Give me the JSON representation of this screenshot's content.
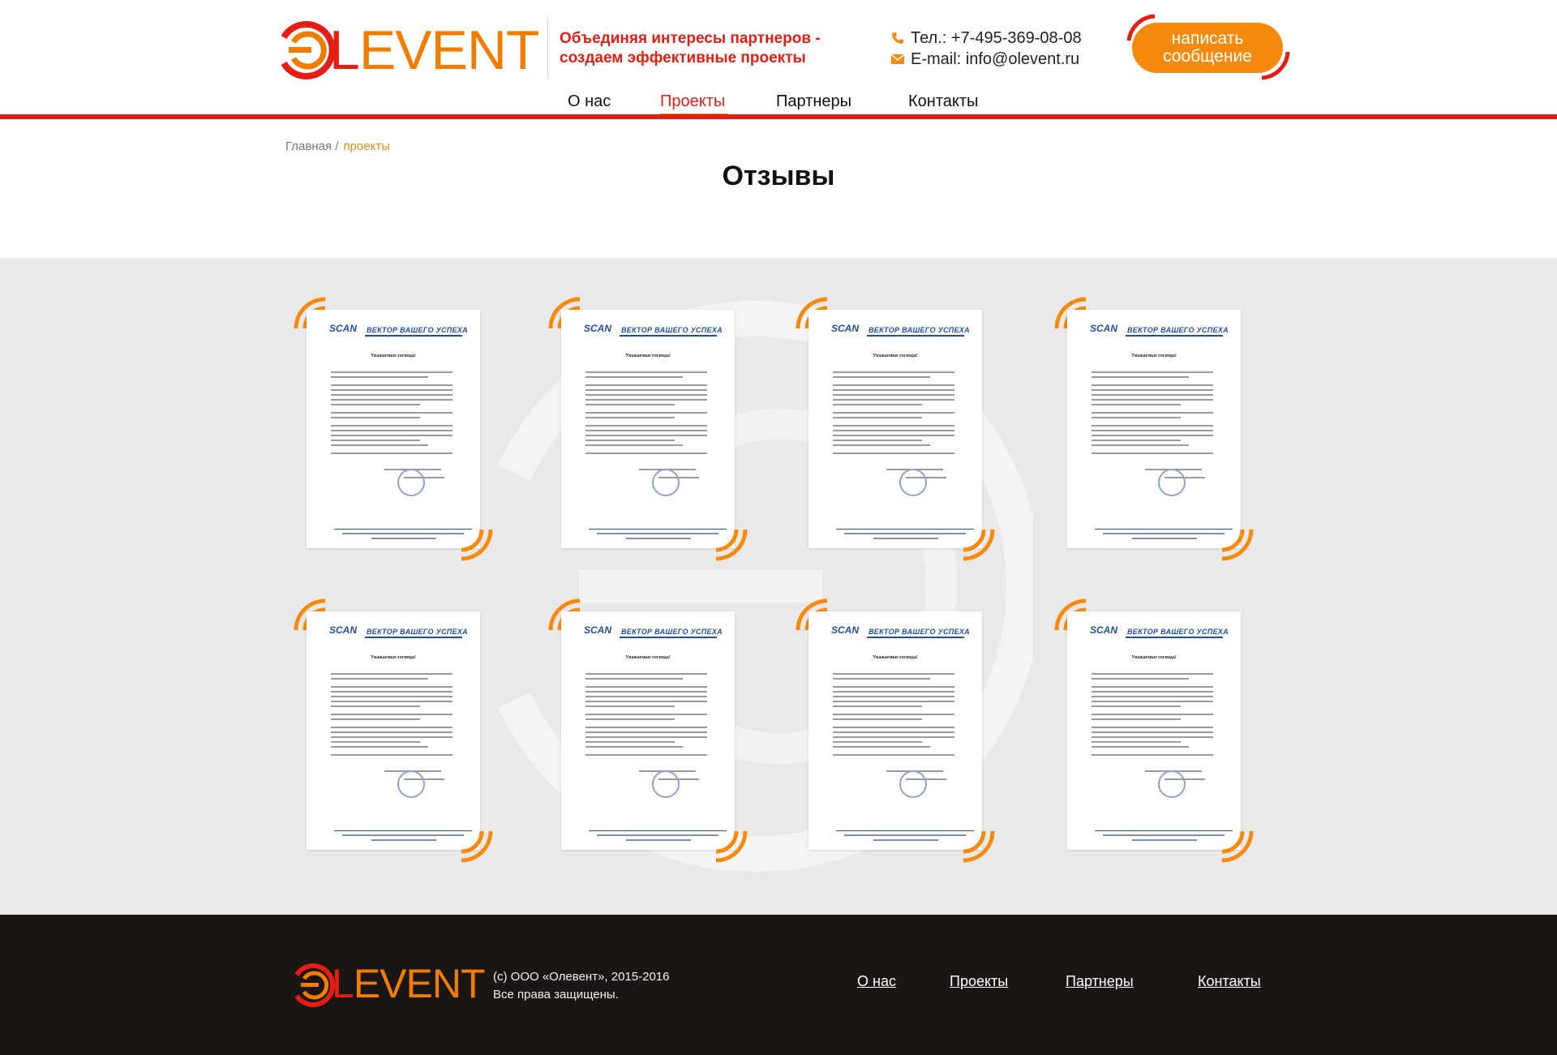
{
  "header": {
    "logo_text_first": "L",
    "logo_text_rest": "EVENT",
    "tagline_line1": "Объединяя интересы партнеров -",
    "tagline_line2": "создаем эффективные проекты",
    "phone": "Тел.: +7-495-369-08-08",
    "email": "E-mail: info@olevent.ru",
    "message_button_label": "написать сообщение",
    "icons": {
      "phone": "phone-icon",
      "email": "envelope-icon"
    },
    "nav": [
      {
        "label": "О нас",
        "active": false
      },
      {
        "label": "Проекты",
        "active": true
      },
      {
        "label": "Партнеры",
        "active": false
      },
      {
        "label": "Контакты",
        "active": false
      }
    ]
  },
  "breadcrumb": {
    "home": "Главная /",
    "current": "проекты"
  },
  "page_title": "Отзывы",
  "reviews": {
    "items": [
      {
        "scan": "SCAN",
        "motto": "ВЕКТОР ВАШЕГО УСПЕХА",
        "greeting": "Уважаемые господа!"
      },
      {
        "scan": "SCAN",
        "motto": "ВЕКТОР ВАШЕГО УСПЕХА",
        "greeting": "Уважаемые господа!"
      },
      {
        "scan": "SCAN",
        "motto": "ВЕКТОР ВАШЕГО УСПЕХА",
        "greeting": "Уважаемые господа!"
      },
      {
        "scan": "SCAN",
        "motto": "ВЕКТОР ВАШЕГО УСПЕХА",
        "greeting": "Уважаемые господа!"
      },
      {
        "scan": "SCAN",
        "motto": "ВЕКТОР ВАШЕГО УСПЕХА",
        "greeting": "Уважаемые господа!"
      },
      {
        "scan": "SCAN",
        "motto": "ВЕКТОР ВАШЕГО УСПЕХА",
        "greeting": "Уважаемые господа!"
      },
      {
        "scan": "SCAN",
        "motto": "ВЕКТОР ВАШЕГО УСПЕХА",
        "greeting": "Уважаемые господа!"
      },
      {
        "scan": "SCAN",
        "motto": "ВЕКТОР ВАШЕГО УСПЕХА",
        "greeting": "Уважаемые господа!"
      }
    ]
  },
  "footer": {
    "logo_text_first": "L",
    "logo_text_rest": "EVENT",
    "copyright_line1": "(c) ООО «Олевент», 2015-2016",
    "copyright_line2": "Все права защищены.",
    "nav": [
      "О нас",
      "Проекты",
      "Партнеры",
      "Контакты"
    ]
  },
  "colors": {
    "accent_orange": "#f58a0e",
    "brand_red": "#e41e13",
    "footer_bg": "#1a1614",
    "gallery_bg": "#e9e9e9"
  }
}
